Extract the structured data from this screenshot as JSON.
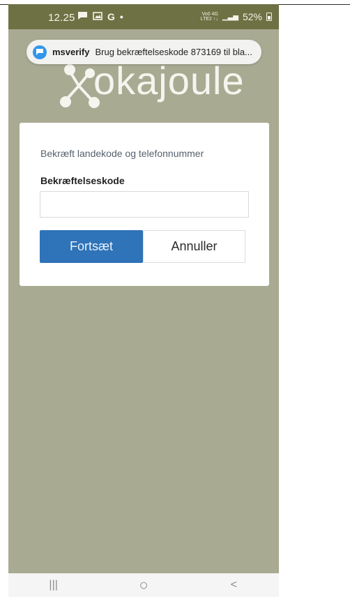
{
  "status_bar": {
    "time": "12.25",
    "left_icons": [
      "message-icon",
      "gallery-icon",
      "google-g-icon",
      "dot-icon"
    ],
    "network_top": "Vo0 4G",
    "network_bottom": "LTE2 ↑↓",
    "signal": "▁▃▅",
    "battery_percent": "52%"
  },
  "notification": {
    "app": "msverify",
    "text": "Brug bekræftelseskode 873169 til bla..."
  },
  "logo": {
    "word": "okajoule",
    "colors": {
      "text": "#f5f5ef",
      "nodes": "#f5f5ef"
    }
  },
  "dialog": {
    "description": "Bekræft landekode og telefonnummer",
    "code_label": "Bekræftelseskode",
    "code_value": "",
    "continue_button": "Fortsæt",
    "cancel_button": "Annuller"
  },
  "navigation": {
    "recent_glyph": "|||",
    "home_glyph": "○",
    "back_glyph": "<"
  },
  "colors": {
    "background": "#a9aa92",
    "status_bar": "#6e7143",
    "primary": "#2f73b8",
    "notification_icon": "#3196ea"
  }
}
